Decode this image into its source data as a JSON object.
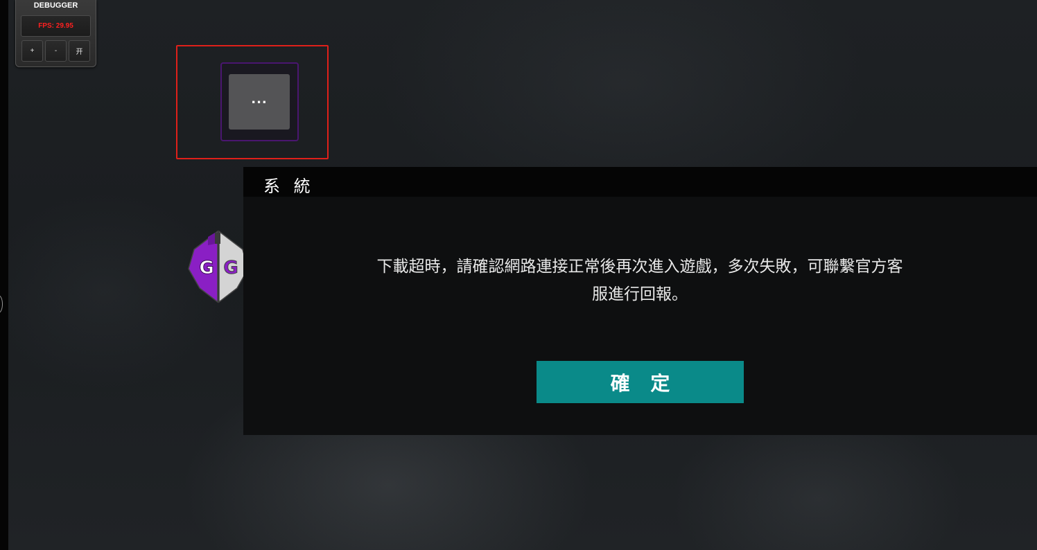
{
  "debugger": {
    "title": "DEBUGGER",
    "fps_text": "FPS: 29.95",
    "plus_label": "+",
    "minus_label": "-",
    "toggle_label": "开"
  },
  "menu_button": {
    "label": "..."
  },
  "dialog": {
    "title": "系 統",
    "message_line1": "下載超時，請確認網路連接正常後再次進入遊戲，多次失敗，可聯繫官方客",
    "message_line2": "服進行回報。",
    "confirm_label": "確 定"
  },
  "logo": {
    "letters": "GG"
  },
  "colors": {
    "confirm_button": "#0a8a89",
    "highlight_border": "#e0201a",
    "fps_text": "#ff2020",
    "gg_purple": "#8a1fc4"
  }
}
